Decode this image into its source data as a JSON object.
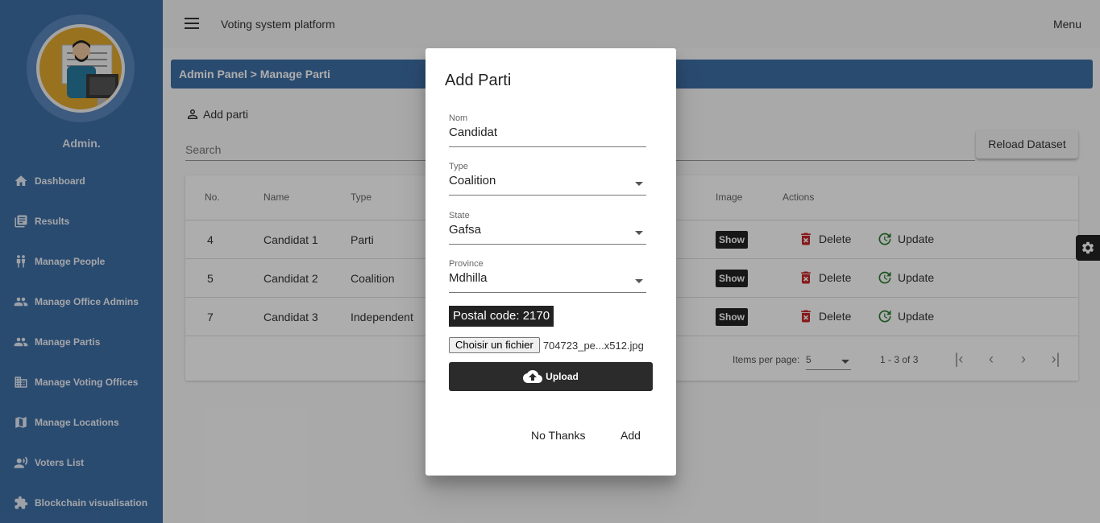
{
  "header": {
    "title": "Voting system platform",
    "menu_label": "Menu"
  },
  "sidebar": {
    "admin_name": "Admin.",
    "items": [
      {
        "label": "Dashboard",
        "icon": "home-icon"
      },
      {
        "label": "Results",
        "icon": "list-icon"
      },
      {
        "label": "Manage People",
        "icon": "people-icon"
      },
      {
        "label": "Manage Office Admins",
        "icon": "group-icon"
      },
      {
        "label": "Manage Partis",
        "icon": "group-icon"
      },
      {
        "label": "Manage Voting Offices",
        "icon": "building-icon"
      },
      {
        "label": "Manage Locations",
        "icon": "map-icon"
      },
      {
        "label": "Voters List",
        "icon": "voter-icon"
      },
      {
        "label": "Blockchain visualisation",
        "icon": "puzzle-icon"
      }
    ]
  },
  "breadcrumb": "Admin Panel > Manage Parti",
  "toolbar": {
    "add_parti_label": "Add parti",
    "search_placeholder": "Search",
    "reload_label": "Reload Dataset"
  },
  "table": {
    "columns": [
      "No.",
      "Name",
      "Type",
      "Image",
      "Actions"
    ],
    "rows": [
      {
        "no": "4",
        "name": "Candidat 1",
        "type": "Parti",
        "image_btn": "Show",
        "delete": "Delete",
        "update": "Update"
      },
      {
        "no": "5",
        "name": "Candidat 2",
        "type": "Coalition",
        "image_btn": "Show",
        "delete": "Delete",
        "update": "Update"
      },
      {
        "no": "7",
        "name": "Candidat 3",
        "type": "Independent",
        "image_btn": "Show",
        "delete": "Delete",
        "update": "Update"
      }
    ],
    "paginator": {
      "items_per_page_label": "Items per page:",
      "items_per_page": "5",
      "range": "1 - 3 of 3"
    }
  },
  "dialog": {
    "title": "Add Parti",
    "fields": {
      "nom": {
        "label": "Nom",
        "value": "Candidat"
      },
      "type": {
        "label": "Type",
        "value": "Coalition"
      },
      "state": {
        "label": "State",
        "value": "Gafsa"
      },
      "province": {
        "label": "Province",
        "value": "Mdhilla"
      }
    },
    "postal_code": "Postal code: 2170",
    "file_button": "Choisir un fichier",
    "file_name": "704723_pe...x512.jpg",
    "upload_label": "Upload",
    "cancel_label": "No Thanks",
    "add_label": "Add"
  },
  "colors": {
    "primary": "#3f6fa6",
    "delete": "#c62828",
    "update": "#2e7d32"
  }
}
